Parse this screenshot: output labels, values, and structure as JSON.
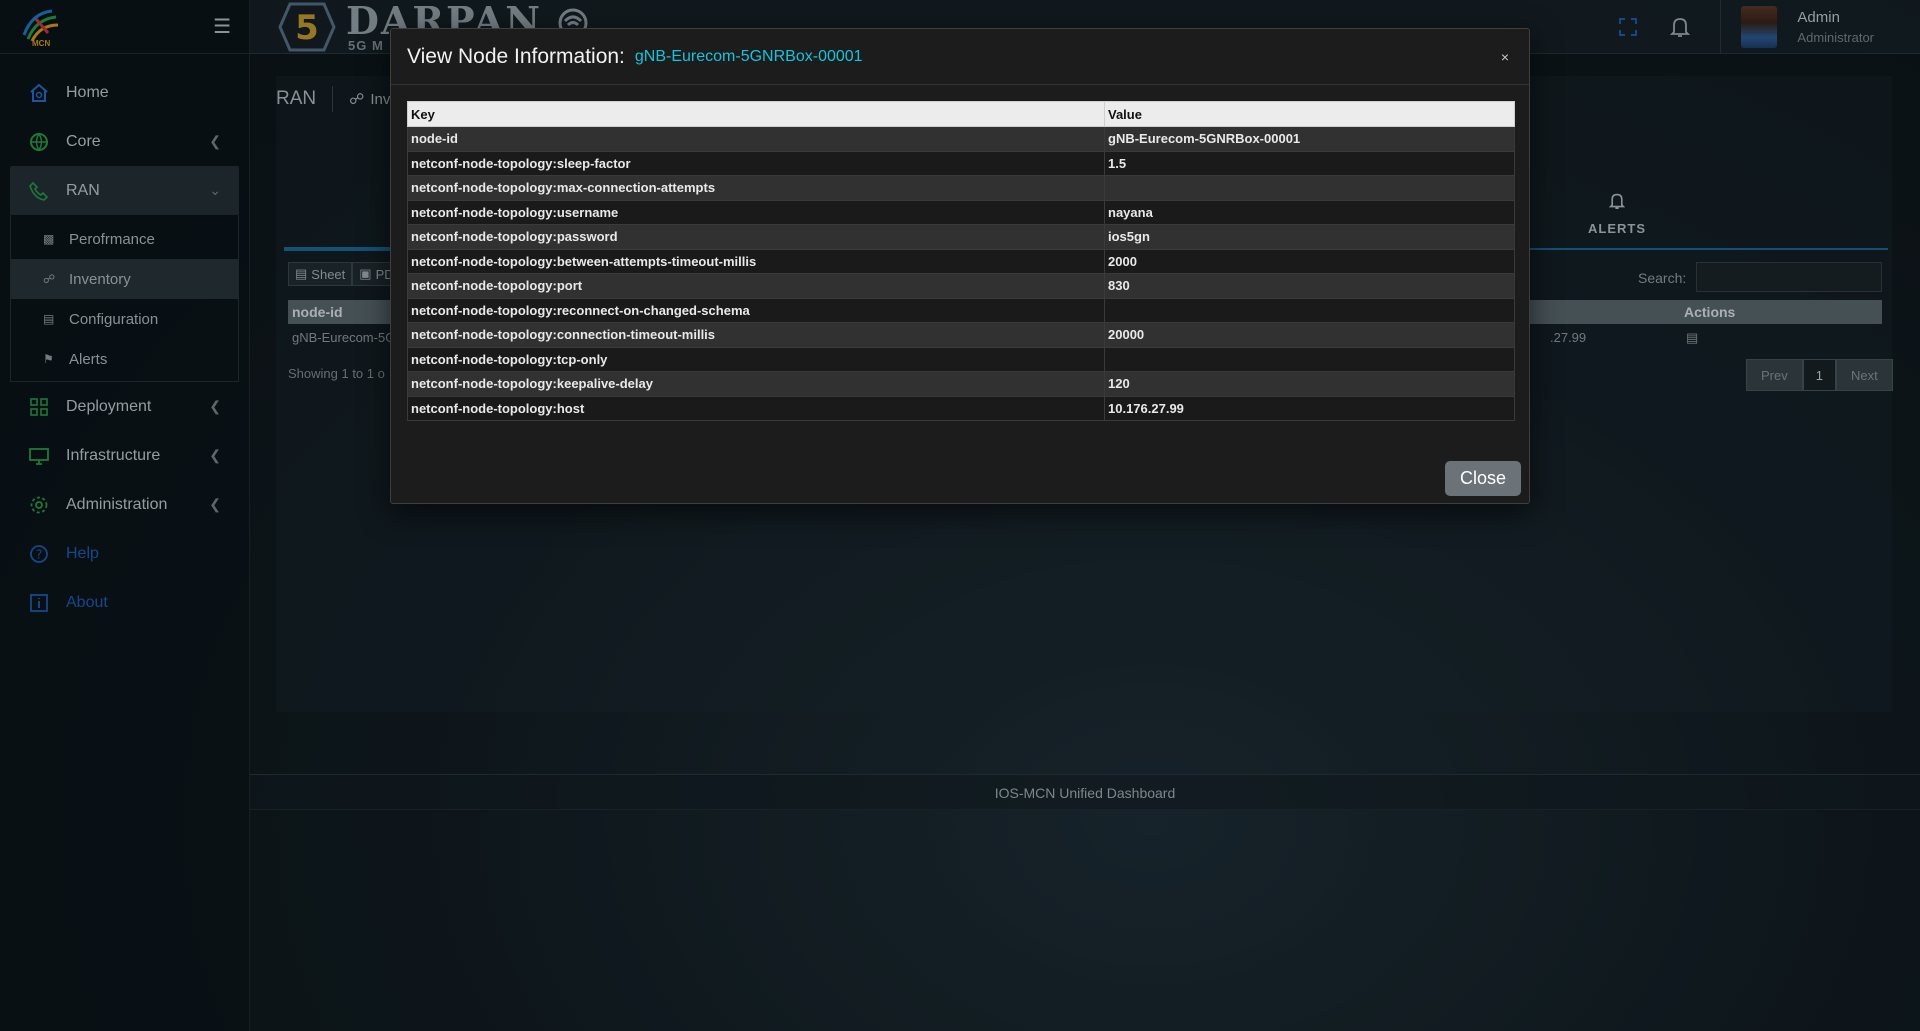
{
  "sidebar": {
    "logo_text": "MCN",
    "items": [
      {
        "label": "Home",
        "icon": "home-icon"
      },
      {
        "label": "Core",
        "icon": "globe-icon"
      },
      {
        "label": "RAN",
        "icon": "phone-icon"
      },
      {
        "label": "Deployment",
        "icon": "grid-icon"
      },
      {
        "label": "Infrastructure",
        "icon": "monitor-icon"
      },
      {
        "label": "Administration",
        "icon": "gear-icon"
      },
      {
        "label": "Help",
        "icon": "help-icon"
      },
      {
        "label": "About",
        "icon": "info-icon"
      }
    ],
    "ran_subitems": [
      {
        "label": "Perofrmance",
        "icon": "bar-chart-icon"
      },
      {
        "label": "Inventory",
        "icon": "topology-icon"
      },
      {
        "label": "Configuration",
        "icon": "list-icon"
      },
      {
        "label": "Alerts",
        "icon": "bell-icon"
      }
    ]
  },
  "header": {
    "brand_title": "DARPAN",
    "brand_sub": "5G M",
    "user_name": "Admin",
    "user_role": "Administrator"
  },
  "main": {
    "breadcrumb_section": "RAN",
    "breadcrumb_page": "Inv",
    "alerts_tab": "ALERTS",
    "toolbar": {
      "sheet": "Sheet",
      "pdf": "PDF"
    },
    "search_label": "Search:",
    "table": {
      "col_node_id": "node-id",
      "col_actions": "Actions",
      "row_node_id": "gNB-Eurecom-5G",
      "row_host_tail": ".27.99"
    },
    "showing": "Showing 1 to 1 o",
    "pager": {
      "prev": "Prev",
      "page": "1",
      "next": "Next"
    }
  },
  "footer": {
    "text": "IOS-MCN Unified Dashboard"
  },
  "modal": {
    "title": "View Node Information:",
    "node": "gNB-Eurecom-5GNRBox-00001",
    "close_x": "×",
    "close_button": "Close",
    "columns": {
      "key": "Key",
      "value": "Value"
    },
    "rows": [
      {
        "key": "node-id",
        "value": "gNB-Eurecom-5GNRBox-00001"
      },
      {
        "key": "netconf-node-topology:sleep-factor",
        "value": "1.5"
      },
      {
        "key": "netconf-node-topology:max-connection-attempts",
        "value": ""
      },
      {
        "key": "netconf-node-topology:username",
        "value": "nayana"
      },
      {
        "key": "netconf-node-topology:password",
        "value": "ios5gn"
      },
      {
        "key": "netconf-node-topology:between-attempts-timeout-millis",
        "value": "2000"
      },
      {
        "key": "netconf-node-topology:port",
        "value": "830"
      },
      {
        "key": "netconf-node-topology:reconnect-on-changed-schema",
        "value": ""
      },
      {
        "key": "netconf-node-topology:connection-timeout-millis",
        "value": "20000"
      },
      {
        "key": "netconf-node-topology:tcp-only",
        "value": ""
      },
      {
        "key": "netconf-node-topology:keepalive-delay",
        "value": "120"
      },
      {
        "key": "netconf-node-topology:host",
        "value": "10.176.27.99"
      }
    ]
  },
  "colors": {
    "accent": "#17c3dc",
    "link": "#1f5fb8",
    "tab_line": "#1a6d9c"
  }
}
